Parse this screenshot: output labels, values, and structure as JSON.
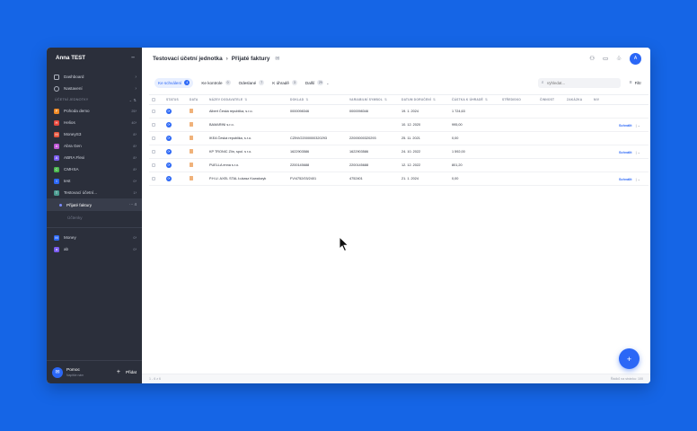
{
  "sidebar": {
    "account": "Anna TEST",
    "minimize_icon": "minus-icon",
    "nav": [
      {
        "label": "Dashboard",
        "icon": "dashboard-icon"
      },
      {
        "label": "Nastavení",
        "icon": "settings-icon"
      }
    ],
    "section_label": "ÚČETNÍ JEDNOTKY",
    "units": [
      {
        "label": "Pohoda demo",
        "count": "25",
        "color": "#f08a24",
        "letter": "P"
      },
      {
        "label": "Helios",
        "count": "40",
        "color": "#e8473c",
        "letter": "H"
      },
      {
        "label": "MoneyS3",
        "count": "8",
        "color": "#e8543c",
        "letter": "M"
      },
      {
        "label": "Abra Gen",
        "count": "8",
        "color": "#c058d6",
        "letter": "A"
      },
      {
        "label": "ABRA Flexi",
        "count": "8",
        "color": "#7b5cf0",
        "letter": "A"
      },
      {
        "label": "CMHSA",
        "count": "8",
        "color": "#4bb84e",
        "letter": "C"
      },
      {
        "label": "test",
        "count": "0",
        "color": "#2b67f6",
        "letter": "t"
      },
      {
        "label": "Testovací účetní...",
        "count": "1",
        "color": "#4a9a8f",
        "letter": "T"
      }
    ],
    "sub_active": "Přijaté faktury",
    "sub_active_actions": "⋯  4",
    "sub_inactive": "Účtenky",
    "units2": [
      {
        "label": "Money",
        "count": "0",
        "color": "#2b67f6",
        "letter": "M"
      },
      {
        "label": "ab",
        "count": "0",
        "color": "#7b5cf0",
        "letter": "a"
      }
    ],
    "help_title": "Pomoc",
    "help_subtitle": "Napište nám",
    "add_label": "Přidat"
  },
  "header": {
    "breadcrumb_parent": "Testovací účetní jednotka",
    "breadcrumb_sep": "›",
    "breadcrumb_current": "Přijaté faktury",
    "avatar_letter": "A"
  },
  "filters": {
    "tabs": [
      {
        "label": "Ke schválení",
        "count": "4",
        "active": true
      },
      {
        "label": "Ke kontrole",
        "count": "0",
        "active": false
      },
      {
        "label": "Odeslané",
        "count": "7",
        "active": false
      },
      {
        "label": "K úhradě",
        "count": "3",
        "active": false
      },
      {
        "label": "Další",
        "count": "29",
        "active": false
      }
    ],
    "search_placeholder": "Vyhledat...",
    "filter_label": "Filtr"
  },
  "table": {
    "columns": [
      "STATUS",
      "DATA",
      "NÁZEV DODAVATELE",
      "DOKLAD",
      "VARIABILNÍ SYMBOL",
      "DATUM DORUČENÍ",
      "ČÁSTKA K ÚHRADĚ",
      "STŘEDISKO",
      "ČINNOST",
      "ZAKÁZKA",
      "NIV"
    ],
    "rows": [
      {
        "supplier": "Albert Česká republika, s.r.o.",
        "doc": "0000098346",
        "vs": "0000098346",
        "date": "19. 1. 2024",
        "amount": "1 724,63",
        "action": ""
      },
      {
        "supplier": "BAMARINI s.r.o.",
        "doc": "",
        "vs": "",
        "date": "10. 12. 2020",
        "amount": "995,00",
        "action": "Schválit"
      },
      {
        "supplier": "IKEA Česká republika, s.r.o.",
        "doc": "CZINV22000000320293",
        "vs": "22000000320293",
        "date": "25. 11. 2021",
        "amount": "0,00",
        "action": ""
      },
      {
        "supplier": "KP TRONIC Zlín, spol. s r.o.",
        "doc": "1622903586",
        "vs": "1622903586",
        "date": "24. 10. 2022",
        "amount": "1 592,00",
        "action": "Schválit"
      },
      {
        "supplier": "PUELLA enna s.r.o.",
        "doc": "2200145688",
        "vs": "2200145688",
        "date": "12. 12. 2022",
        "amount": "801,20",
        "action": ""
      },
      {
        "supplier": "P.H.U. AXEL STAL Łukasz Kowalczyk",
        "doc": "FV/4752/03/2401",
        "vs": "4752401",
        "date": "21. 1. 2024",
        "amount": "0,00",
        "action": "Schválit"
      }
    ]
  },
  "footer": {
    "left": "1 - 6 z 6",
    "rows_per_page": "Řádků na stránku: 100"
  },
  "fab_label": "+"
}
